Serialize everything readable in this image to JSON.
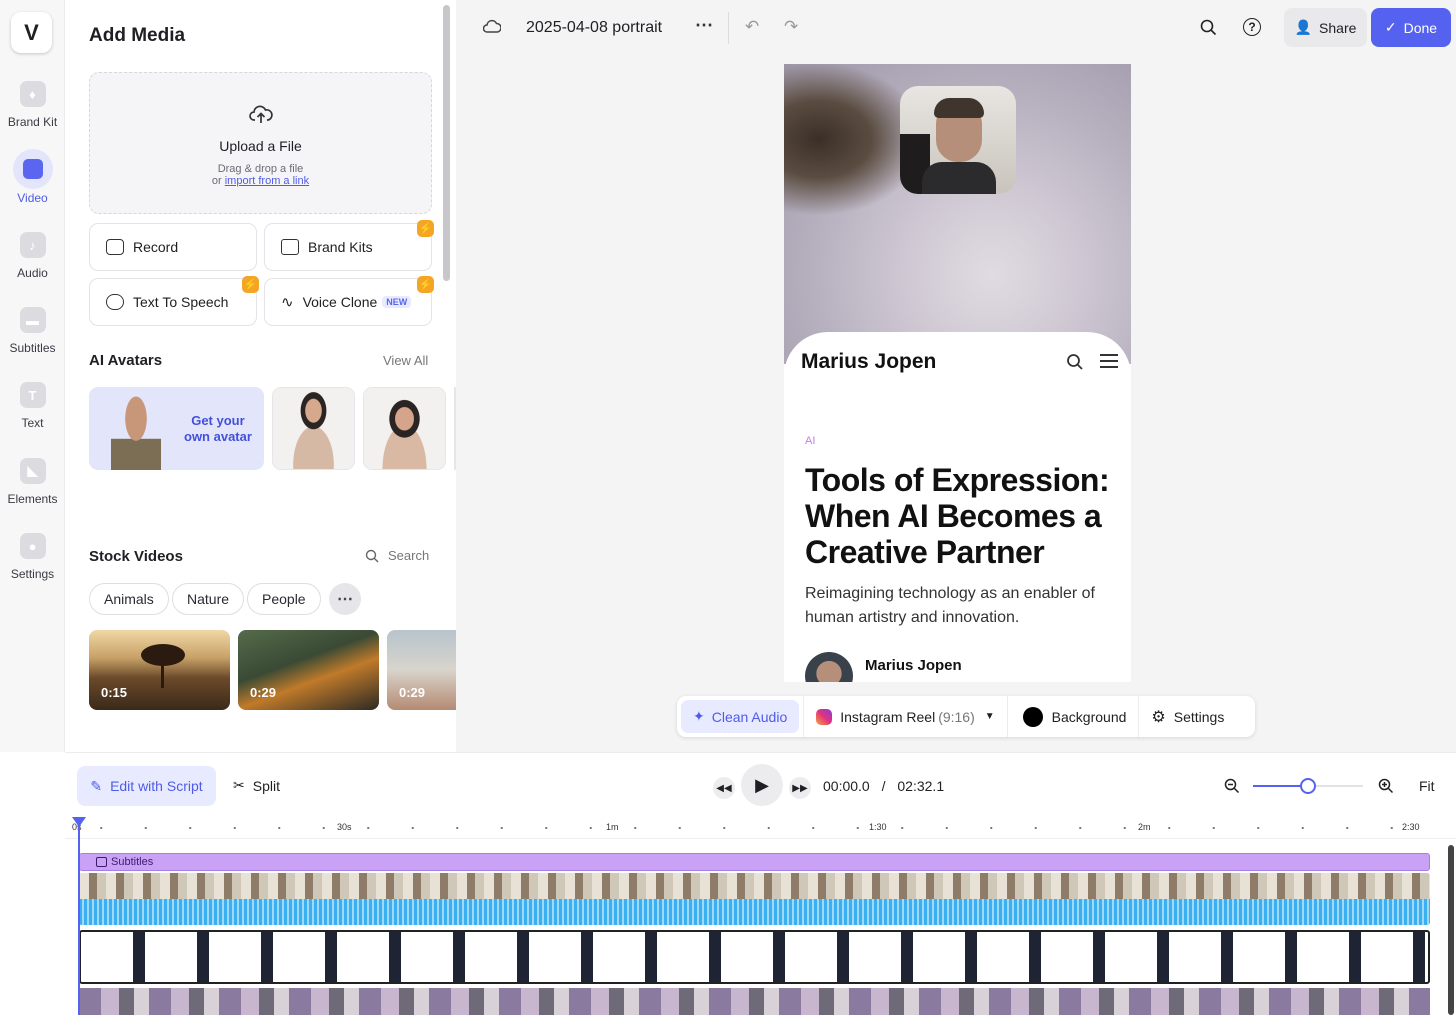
{
  "nav": {
    "logo": "V",
    "items": [
      {
        "label": "Brand Kit",
        "icon": "brand-kit-icon"
      },
      {
        "label": "Video",
        "icon": "video-icon",
        "active": true
      },
      {
        "label": "Audio",
        "icon": "music-note-icon"
      },
      {
        "label": "Subtitles",
        "icon": "subtitles-icon"
      },
      {
        "label": "Text",
        "icon": "text-icon"
      },
      {
        "label": "Elements",
        "icon": "elements-icon"
      },
      {
        "label": "Settings",
        "icon": "settings-icon"
      }
    ]
  },
  "panel": {
    "title": "Add Media",
    "upload": {
      "title": "Upload a File",
      "hint": "Drag & drop a file",
      "or": "or",
      "link": "import from a link"
    },
    "cards": {
      "record": "Record",
      "brand_kits": "Brand Kits",
      "tts": "Text To Speech",
      "voice_clone": "Voice Clone",
      "new": "NEW"
    },
    "avatars": {
      "title": "AI Avatars",
      "view_all": "View All",
      "get_avatar_1": "Get your",
      "get_avatar_2": "own avatar"
    },
    "stock": {
      "title": "Stock Videos",
      "search": "Search",
      "chips": [
        "Animals",
        "Nature",
        "People"
      ],
      "durations": [
        "0:15",
        "0:29",
        "0:29"
      ]
    }
  },
  "topbar": {
    "project": "2025-04-08 portrait",
    "share": "Share",
    "done": "Done"
  },
  "canvas": {
    "site_name": "Marius Jopen",
    "tag": "AI",
    "headline_1": "Tools of Expression:",
    "headline_2": "When AI Becomes a",
    "headline_3": "Creative Partner",
    "sub_1": "Reimagining technology as an enabler of",
    "sub_2": "human artistry and innovation.",
    "author": "Marius Jopen"
  },
  "toolbar": {
    "clean_audio": "Clean Audio",
    "format": "Instagram Reel",
    "ratio": "(9:16)",
    "background": "Background",
    "settings": "Settings"
  },
  "timeline": {
    "edit_script": "Edit with Script",
    "split": "Split",
    "current": "00:00.0",
    "sep": "/",
    "total": "02:32.1",
    "fit": "Fit",
    "ticks": [
      "0s",
      "30s",
      "1m",
      "1:30",
      "2m",
      "2:30"
    ],
    "zoom_level": 0.5,
    "subtitles_label": "Subtitles"
  },
  "colors": {
    "accent": "#5562ef",
    "subtitle_track": "#c9a2f5",
    "audio_wave": "#3ab0f2",
    "bolt": "#f5a524"
  }
}
